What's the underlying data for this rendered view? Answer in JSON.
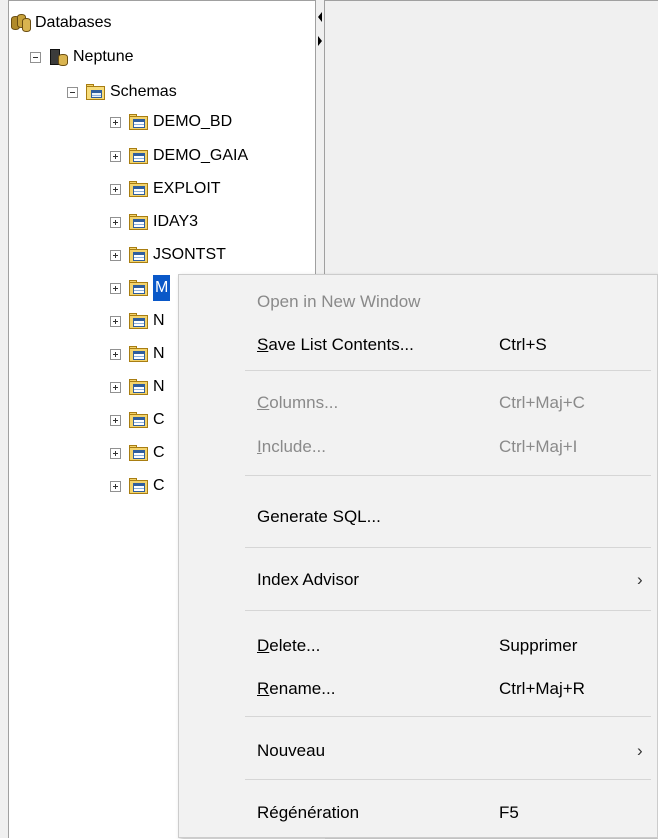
{
  "tree": {
    "root": {
      "label": "Databases",
      "icon": "databases-icon"
    },
    "server": {
      "label": "Neptune",
      "icon": "server-icon",
      "expander": "minus"
    },
    "schemas": {
      "label": "Schemas",
      "icon": "schemas-folder-icon",
      "expander": "minus"
    },
    "schema_items": [
      {
        "label": "DEMO_BD"
      },
      {
        "label": "DEMO_GAIA"
      },
      {
        "label": "EXPLOIT"
      },
      {
        "label": "IDAY3"
      },
      {
        "label": "JSONTST"
      },
      {
        "label": "M",
        "selected": true
      },
      {
        "label": "N"
      },
      {
        "label": "N"
      },
      {
        "label": "N"
      },
      {
        "label": "C"
      },
      {
        "label": "C"
      },
      {
        "label": "C"
      }
    ]
  },
  "context_menu": {
    "items": [
      {
        "label": "Open in New Window",
        "shortcut": "",
        "disabled": true
      },
      {
        "label_prefix": "",
        "label_mnemonic": "S",
        "label_rest": "ave List Contents...",
        "shortcut": "Ctrl+S",
        "disabled": false
      },
      {
        "label_prefix": "",
        "label_mnemonic": "C",
        "label_rest": "olumns...",
        "shortcut": "Ctrl+Maj+C",
        "disabled": true
      },
      {
        "label_prefix": "",
        "label_mnemonic": "I",
        "label_rest": "nclude...",
        "shortcut": "Ctrl+Maj+I",
        "disabled": true
      },
      {
        "label": "Generate SQL...",
        "shortcut": "",
        "disabled": false
      },
      {
        "label": "Index Advisor",
        "shortcut": "",
        "submenu": true,
        "disabled": false
      },
      {
        "label_prefix": "",
        "label_mnemonic": "D",
        "label_rest": "elete...",
        "shortcut": "Supprimer",
        "disabled": false
      },
      {
        "label_prefix": "",
        "label_mnemonic": "R",
        "label_rest": "ename...",
        "shortcut": "Ctrl+Maj+R",
        "disabled": false
      },
      {
        "label": "Nouveau",
        "shortcut": "",
        "submenu": true,
        "disabled": false
      },
      {
        "label": "Régénération",
        "shortcut": "F5",
        "disabled": false
      }
    ],
    "submenu_arrow": "›"
  },
  "colors": {
    "selection": "#0a58c8",
    "menu_bg": "#f2f2f2",
    "disabled_text": "#8a8a8a"
  }
}
